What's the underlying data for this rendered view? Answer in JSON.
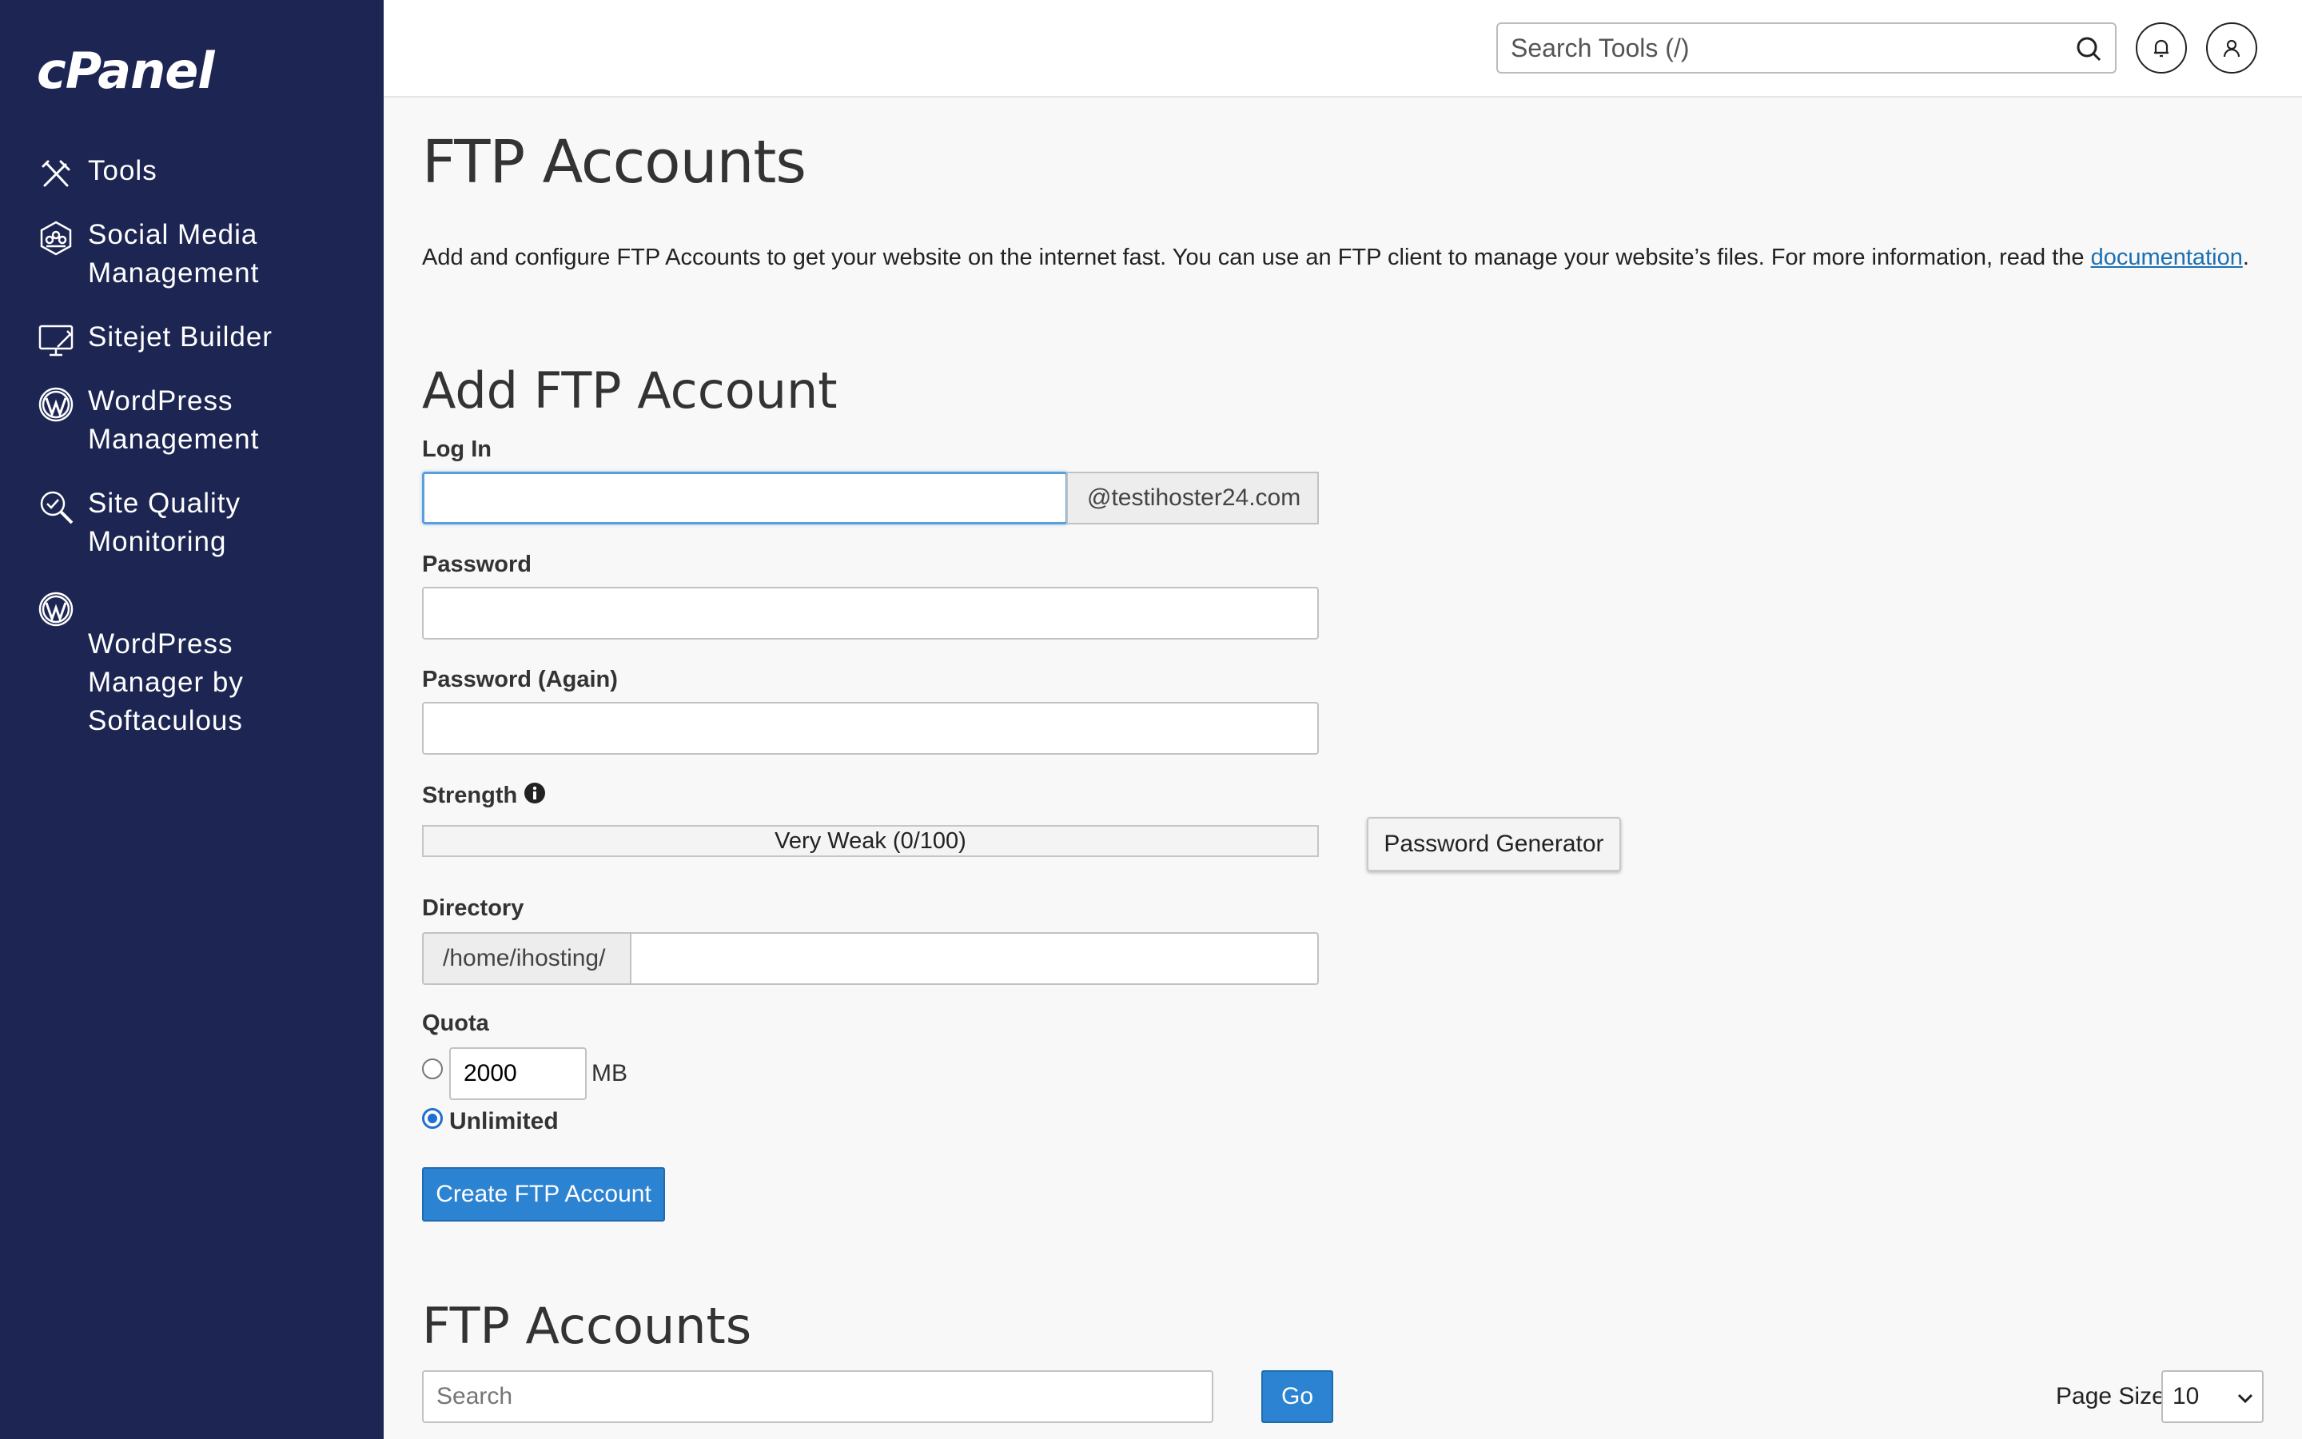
{
  "sidebar": {
    "logo": "cPanel",
    "items": [
      {
        "label": "Tools",
        "icon": "tools-icon"
      },
      {
        "label": "Social Media\nManagement",
        "icon": "social-media-icon"
      },
      {
        "label": "Sitejet Builder",
        "icon": "sitejet-icon"
      },
      {
        "label": "WordPress\nManagement",
        "icon": "wordpress-icon"
      },
      {
        "label": "Site Quality\nMonitoring",
        "icon": "site-quality-icon"
      },
      {
        "label": " WordPress\n Manager by\nSoftaculous",
        "icon": "wordpress-icon"
      }
    ]
  },
  "header": {
    "search_placeholder": "Search Tools (/)",
    "notifications_icon": "bell-icon",
    "user_icon": "user-icon"
  },
  "page": {
    "title": "FTP Accounts",
    "intro": "Add and configure FTP Accounts to get your website on the internet fast. You can use an FTP client to manage your website’s files. For more information, read the",
    "intro_link": "documentation",
    "intro_end": "."
  },
  "add_form": {
    "title": "Add FTP Account",
    "login_label": "Log In",
    "login_value": "",
    "domain_suffix": "@testihoster24.com",
    "password_label": "Password",
    "password_again_label": "Password (Again)",
    "strength_label": "Strength",
    "strength_text": "Very Weak (0/100)",
    "strength_percent": 0,
    "password_generator_label": "Password Generator",
    "directory_label": "Directory",
    "directory_prefix": "/home/ihosting/",
    "directory_value": "",
    "quota_label": "Quota",
    "quota_value": "2000",
    "quota_unit": "MB",
    "unlimited_label": "Unlimited",
    "quota_mode": "unlimited",
    "submit_label": "Create FTP Account"
  },
  "accounts": {
    "title": "FTP Accounts",
    "search_placeholder": "Search",
    "go_label": "Go",
    "page_size_label": "Page Size",
    "page_size_value": "10"
  },
  "colors": {
    "sidebar_bg": "#1d2653",
    "primary_button": "#2c83d2",
    "link": "#1b6fb3"
  }
}
